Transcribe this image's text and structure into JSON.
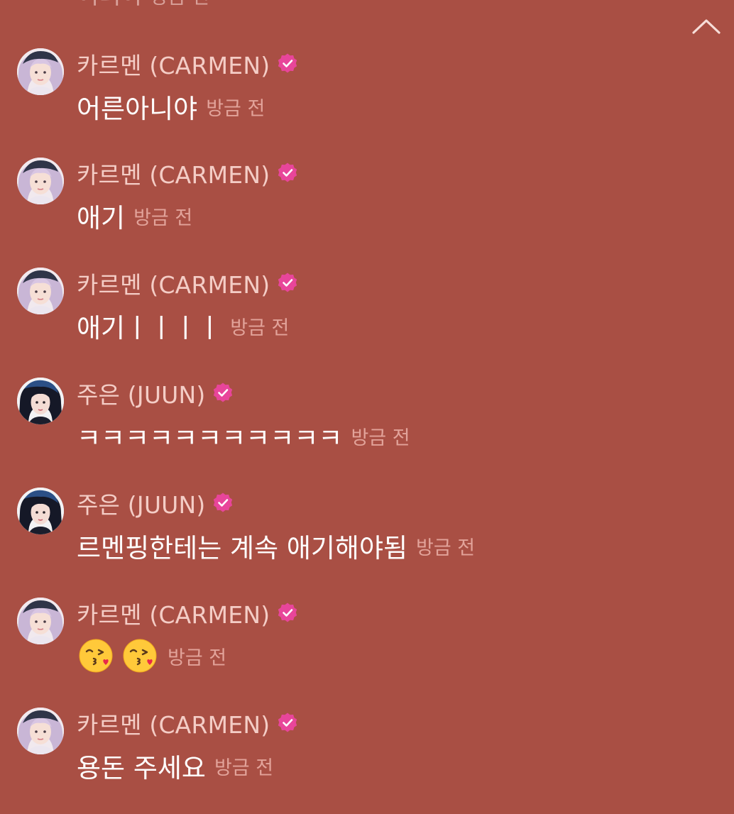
{
  "colors": {
    "background": "#a94f44",
    "name": "#f4cdc6",
    "message": "#ffffff",
    "timestamp": "#e2a39a",
    "verified_badge": "#e8459a"
  },
  "top_partial": {
    "text": "어리야",
    "time": "방금 전"
  },
  "collapse_button": {
    "icon": "chevron-up-icon"
  },
  "messages": [
    {
      "author": "카르멘 (CARMEN)",
      "avatar": "carmen-avatar",
      "verified": true,
      "text": "어른아니야",
      "time": "방금 전"
    },
    {
      "author": "카르멘 (CARMEN)",
      "avatar": "carmen-avatar",
      "verified": true,
      "text": "애기",
      "time": "방금 전"
    },
    {
      "author": "카르멘 (CARMEN)",
      "avatar": "carmen-avatar",
      "verified": true,
      "text": "애기ㅣㅣㅣㅣ",
      "time": "방금 전"
    },
    {
      "author": "주은 (JUUN)",
      "avatar": "juun-avatar",
      "verified": true,
      "text": "ㅋㅋㅋㅋㅋㅋㅋㅋㅋㅋㅋ",
      "time": "방금 전"
    },
    {
      "author": "주은 (JUUN)",
      "avatar": "juun-avatar",
      "verified": true,
      "text": "르멘핑한테는 계속 애기해야됨",
      "time": "방금 전"
    },
    {
      "author": "카르멘 (CARMEN)",
      "avatar": "carmen-avatar",
      "verified": true,
      "text": "😘 😘",
      "emoji": [
        "kissing-heart-emoji",
        "kissing-heart-emoji"
      ],
      "time": "방금 전"
    },
    {
      "author": "카르멘 (CARMEN)",
      "avatar": "carmen-avatar",
      "verified": true,
      "text": "용돈 주세요",
      "time": "방금 전"
    }
  ]
}
